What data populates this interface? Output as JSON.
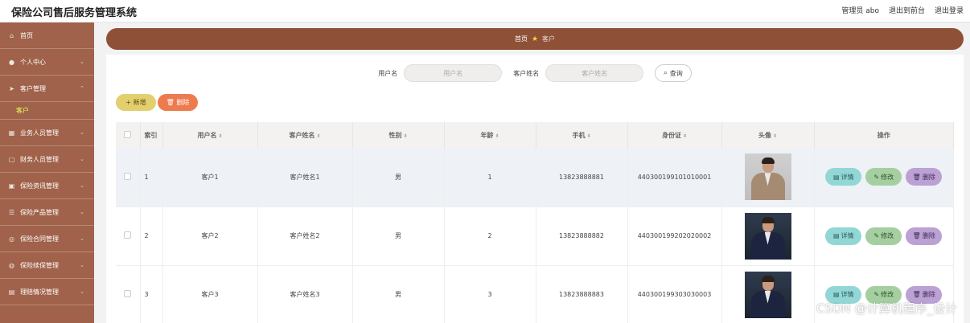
{
  "app_title": "保险公司售后服务管理系统",
  "header_links": {
    "admin": "管理员 abo",
    "to_front": "退出到前台",
    "logout": "退出登录"
  },
  "sidebar": {
    "items": [
      {
        "label": "首页",
        "icon": "home-icon"
      },
      {
        "label": "个人中心",
        "icon": "user-icon"
      },
      {
        "label": "客户管理",
        "icon": "send-icon"
      },
      {
        "label": "业务人员管理",
        "icon": "bank-icon"
      },
      {
        "label": "财务人员管理",
        "icon": "wallet-icon"
      },
      {
        "label": "保险资讯管理",
        "icon": "news-icon"
      },
      {
        "label": "保险产品管理",
        "icon": "list-icon"
      },
      {
        "label": "保险合同管理",
        "icon": "location-icon"
      },
      {
        "label": "保险续保管理",
        "icon": "globe-icon"
      },
      {
        "label": "理赔情况管理",
        "icon": "doc-icon"
      }
    ],
    "active_sub": "客户"
  },
  "breadcrumb": {
    "home": "首页",
    "current": "客户"
  },
  "search": {
    "username_label": "用户名",
    "username_placeholder": "用户名",
    "customer_label": "客户姓名",
    "customer_placeholder": "客户姓名",
    "button": "查询"
  },
  "actions": {
    "add": "新增",
    "delete": "删除"
  },
  "table": {
    "headers": [
      "索引",
      "用户名",
      "客户姓名",
      "性别",
      "年龄",
      "手机",
      "身份证",
      "头像",
      "操作"
    ],
    "rows": [
      {
        "index": "1",
        "username": "客户1",
        "name": "客户姓名1",
        "gender": "男",
        "age": "1",
        "phone": "13823888881",
        "id_card": "440300199101010001"
      },
      {
        "index": "2",
        "username": "客户2",
        "name": "客户姓名2",
        "gender": "男",
        "age": "2",
        "phone": "13823888882",
        "id_card": "440300199202020002"
      },
      {
        "index": "3",
        "username": "客户3",
        "name": "客户姓名3",
        "gender": "男",
        "age": "3",
        "phone": "13823888883",
        "id_card": "440300199303030003"
      }
    ],
    "row_buttons": {
      "detail": "详情",
      "edit": "修改",
      "delete": "删除"
    }
  },
  "watermark": "CSDN @计算机程序_设计",
  "colors": {
    "sidebar": "#a0624a",
    "breadcrumb": "#8e5138",
    "add": "#e3cf6e",
    "delete": "#ee7b4e",
    "detail": "#92d7d6",
    "edit": "#a5cfa0",
    "row_delete": "#bba1d4"
  }
}
